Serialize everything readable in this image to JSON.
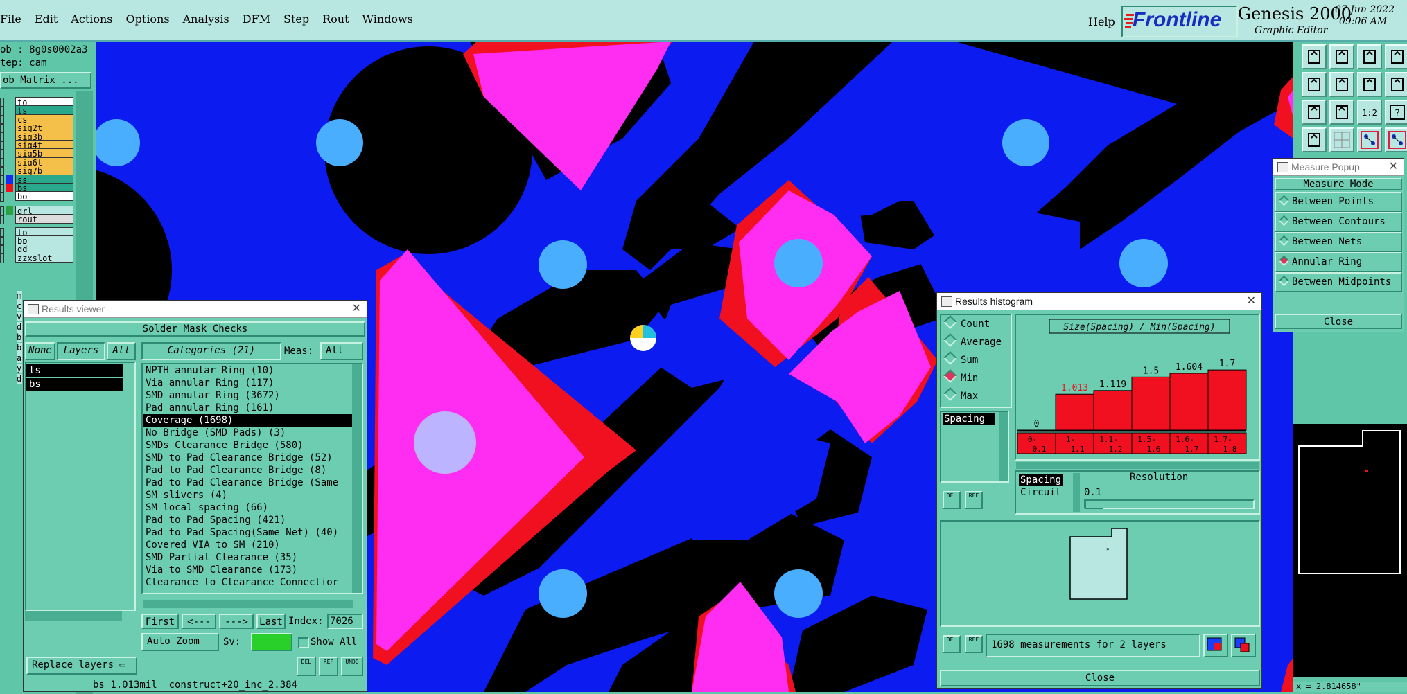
{
  "menubar": {
    "items": [
      {
        "u": "F",
        "rest": "ile"
      },
      {
        "u": "E",
        "rest": "dit"
      },
      {
        "u": "A",
        "rest": "ctions"
      },
      {
        "u": "O",
        "rest": "ptions"
      },
      {
        "u": "A",
        "rest": "nalysis"
      },
      {
        "u": "D",
        "rest": "FM"
      },
      {
        "u": "S",
        "rest": "tep"
      },
      {
        "u": "R",
        "rest": "out"
      },
      {
        "u": "W",
        "rest": "indows"
      }
    ],
    "help": "Help",
    "brand": "Frontline",
    "product": "Genesis 2000",
    "subtitle": "Graphic Editor",
    "date": "07 Jun 2022",
    "time": "09:06 AM"
  },
  "left": {
    "job": "ob : 8g0s0002a3",
    "step": "tep: cam",
    "job_matrix": "ob Matrix ...",
    "layers": [
      {
        "name": "to",
        "bg": "#ffffff",
        "mark": "#ffffff",
        "color": ""
      },
      {
        "name": "ts",
        "bg": "#2aa88c",
        "mark": "#ffffff",
        "color": ""
      },
      {
        "name": "cs",
        "bg": "#f5c04a",
        "mark": "#ffffff",
        "color": ""
      },
      {
        "name": "sig2t",
        "bg": "#f5c04a",
        "mark": "#ffffff",
        "color": ""
      },
      {
        "name": "sig3b",
        "bg": "#f5c04a",
        "mark": "#ffffff",
        "color": ""
      },
      {
        "name": "sig4t",
        "bg": "#f5c04a",
        "mark": "#ffffff",
        "color": ""
      },
      {
        "name": "sig5b",
        "bg": "#f5c04a",
        "mark": "#ffffff",
        "color": ""
      },
      {
        "name": "sig6t",
        "bg": "#f5c04a",
        "mark": "#ffffff",
        "color": ""
      },
      {
        "name": "sig7b",
        "bg": "#f5c04a",
        "mark": "#ffffff",
        "color": ""
      },
      {
        "name": "ss",
        "bg": "#2aa88c",
        "mark": "#ffffff",
        "color": "#1a2cf0"
      },
      {
        "name": "bs",
        "bg": "#2aa88c",
        "mark": "#ffffff",
        "color": "#f01020"
      },
      {
        "name": "bo",
        "bg": "#ffffff",
        "mark": "#ffffff",
        "color": ""
      },
      {
        "name": "drl",
        "bg": "#b8e6e0",
        "mark": "#ffffff",
        "color": "#2aa040"
      },
      {
        "name": "rout",
        "bg": "#dcdcdc",
        "mark": "#ffffff",
        "color": ""
      },
      {
        "name": "tp",
        "bg": "#b8e6e0",
        "mark": "#ffffff",
        "color": ""
      },
      {
        "name": "bp",
        "bg": "#b8e6e0",
        "mark": "#ffffff",
        "color": ""
      },
      {
        "name": "dd",
        "bg": "#b8e6e0",
        "mark": "#ffffff",
        "color": ""
      },
      {
        "name": "zzxslot",
        "bg": "#b8e6e0",
        "mark": "#ffffff",
        "color": ""
      }
    ],
    "cut_letters": [
      "m",
      "c",
      "v",
      "d",
      "b",
      "b",
      "a",
      "y",
      "d"
    ]
  },
  "results_viewer": {
    "title": "Results viewer",
    "header": "Solder Mask Checks",
    "none": "None",
    "layers": "Layers",
    "all": "All",
    "categories": "Categories (21)",
    "meas_label": "Meas:",
    "meas_value": "All",
    "layer_list": [
      "ts",
      "bs"
    ],
    "category_list": [
      "NPTH annular Ring (10)",
      "Via annular Ring (117)",
      "SMD annular Ring (3672)",
      "Pad annular Ring (161)",
      "Coverage (1698)",
      "No Bridge (SMD Pads) (3)",
      "SMDs Clearance Bridge (580)",
      "SMD to Pad Clearance Bridge (52)",
      "Pad to Pad Clearance Bridge (8)",
      "Pad to Pad Clearance Bridge (Same",
      "SM slivers (4)",
      "SM local spacing (66)",
      "Pad to Pad Spacing (421)",
      "Pad to Pad Spacing(Same Net) (40)",
      "Covered VIA to SM (210)",
      "SMD Partial Clearance (35)",
      "Via to SMD Clearance (173)",
      "Clearance to Clearance Connectior"
    ],
    "selected_index": 4,
    "first": "First",
    "prev": "<---",
    "next": "--->",
    "last": "Last",
    "index_label": "Index:",
    "index_value": "7026",
    "auto_zoom": "Auto Zoom",
    "sv_label": "Sv:",
    "show_all": "Show All",
    "replace_layers": "Replace layers",
    "status": "bs 1.013mil  construct+20_inc_2.384",
    "del": "DEL",
    "ref": "REF",
    "undo": "UNDO"
  },
  "histogram": {
    "title": "Results histogram",
    "modes": [
      "Count",
      "Average",
      "Sum",
      "Min",
      "Max"
    ],
    "selected_mode": "Min",
    "chart_title": "Size(Spacing) / Min(Spacing)",
    "spacing_list": [
      "Spacing"
    ],
    "spacing_sel": "Spacing",
    "circuit": "Circuit",
    "resolution_label": "Resolution",
    "resolution_value": "0.1",
    "measurements": "1698 measurements for 2 layers",
    "close": "Close",
    "del": "DEL",
    "ref": "REF",
    "chart_data": {
      "type": "bar",
      "categories": [
        "0-\n0.1",
        "1-\n1.1",
        "1.1-\n1.2",
        "1.5-\n1.6",
        "1.6-\n1.7",
        "1.7-\n1.8"
      ],
      "category_top": [
        "0-",
        "1-",
        "1.1-",
        "1.5-",
        "1.6-",
        "1.7-"
      ],
      "category_bottom": [
        "0.1",
        "1.1",
        "1.2",
        "1.6",
        "1.7",
        "1.8"
      ],
      "values": [
        0,
        1.013,
        1.119,
        1.5,
        1.604,
        1.7
      ],
      "value_labels": [
        "0",
        "1.013",
        "1.119",
        "1.5",
        "1.604",
        "1.7"
      ],
      "highlight_index": 1,
      "title": "Size(Spacing) / Min(Spacing)",
      "ylim": [
        0,
        1.8
      ],
      "bar_color": "#f01020",
      "highlight_color": "#f01020"
    }
  },
  "measure_popup": {
    "title": "Measure Popup",
    "mode_header": "Measure Mode",
    "modes": [
      "Between Points",
      "Between Contours",
      "Between Nets",
      "Annular Ring",
      "Between Midpoints"
    ],
    "selected": "Annular Ring",
    "close": "Close"
  },
  "bottom_right": {
    "coord": "x = 2.814658\""
  },
  "colors": {
    "board": "#0c1cf0",
    "mask": "#000000",
    "pad": "#4aaeff",
    "magenta": "#ff2cf2",
    "red": "#f01020",
    "panel": "#6ccdb0"
  }
}
